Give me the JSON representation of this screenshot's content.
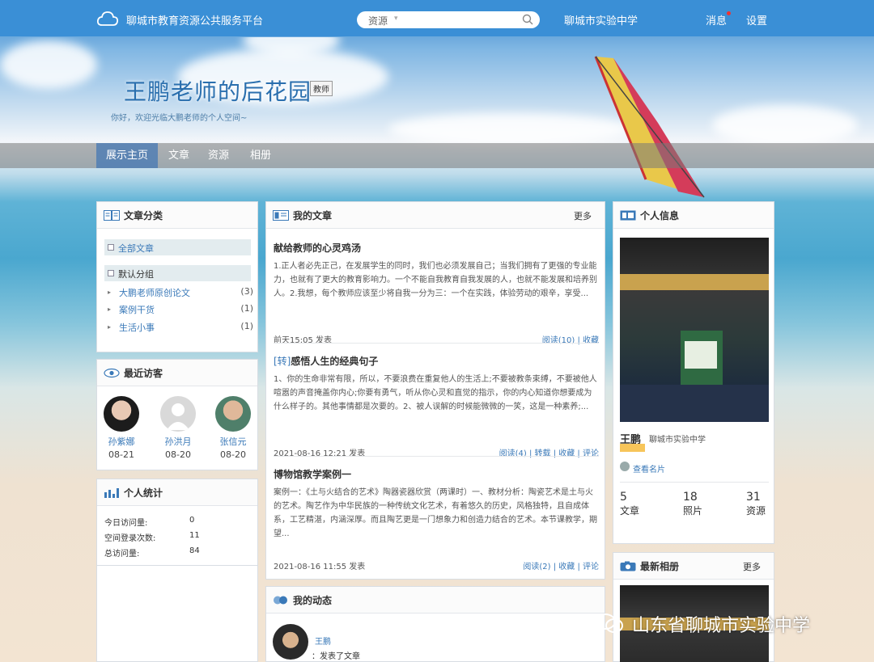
{
  "topbar": {
    "site_title": "聊城市教育资源公共服务平台",
    "search_scope": "资源",
    "search_caret": "▾",
    "school": "聊城市实验中学",
    "messages": "消息",
    "settings": "设置"
  },
  "hero": {
    "title": "王鹏老师的后花园",
    "badge": "教师",
    "subtitle": "你好，欢迎光临大鹏老师的个人空间~"
  },
  "nav": {
    "items": [
      {
        "label": "展示主页",
        "active": true
      },
      {
        "label": "文章",
        "active": false
      },
      {
        "label": "资源",
        "active": false
      },
      {
        "label": "相册",
        "active": false
      }
    ]
  },
  "categories": {
    "title": "文章分类",
    "all": "全部文章",
    "default_group": "默认分组",
    "items": [
      {
        "name": "大鹏老师原创论文",
        "count": "(3)"
      },
      {
        "name": "案例干货",
        "count": "(1)"
      },
      {
        "name": "生活小事",
        "count": "(1)"
      }
    ]
  },
  "visitors": {
    "title": "最近访客",
    "items": [
      {
        "name": "孙紫娜",
        "date": "08-21"
      },
      {
        "name": "孙洪月",
        "date": "08-20"
      },
      {
        "name": "张信元",
        "date": "08-20"
      }
    ]
  },
  "stats": {
    "title": "个人统计",
    "rows": [
      {
        "label": "今日访问量:",
        "value": "0"
      },
      {
        "label": "空间登录次数:",
        "value": "11"
      },
      {
        "label": "总访问量:",
        "value": "84"
      }
    ]
  },
  "articles": {
    "title": "我的文章",
    "more": "更多",
    "items": [
      {
        "tag": "",
        "title": "献给教师的心灵鸡汤",
        "body": "1.正人者必先正己，在发展学生的同时，我们也必须发展自己；当我们拥有了更强的专业能力，也就有了更大的教育影响力。一个不能自我教育自我发展的人，也就不能发展和培养别人。2.我想，每个教师应该至少将自我一分为三：一个在实践，体验劳动的艰辛，享受...",
        "time": "前天15:05 发表",
        "actions": "阅读(10) | 收藏"
      },
      {
        "tag": "[转]",
        "title": "感悟人生的经典句子",
        "body": "1、你的生命非常有限，所以，不要浪费在重复他人的生活上;不要被教条束缚，不要被他人喧嚣的声音掩盖你内心;你要有勇气，听从你心灵和直觉的指示，你的内心知道你想要成为什么样子的。其他事情都是次要的。2、被人误解的时候能微微的一笑，这是一种素养;...",
        "time": "2021-08-16 12:21 发表",
        "actions": "阅读(4) | 转载 | 收藏 | 评论"
      },
      {
        "tag": "",
        "title": "博物馆教学案例一",
        "body": "案例一：《土与火结合的艺术》陶器瓷器欣赏（两课时）一、教材分析：陶瓷艺术是土与火的艺术。陶艺作为中华民族的一种传统文化艺术，有着悠久的历史，风格独特，且自成体系，工艺精湛，内涵深厚。而且陶艺更是一门想象力和创造力结合的艺术。本节课教学，期望...",
        "time": "2021-08-16 11:55 发表",
        "actions": "阅读(2) | 收藏 | 评论"
      }
    ]
  },
  "dynamics": {
    "title": "我的动态",
    "user": "王鹏",
    "action": "：发表了文章"
  },
  "profile": {
    "title": "个人信息",
    "name": "王鹏",
    "school": "聊城市实验中学",
    "view_card": "查看名片",
    "stats": [
      {
        "value": "5",
        "label": "文章"
      },
      {
        "value": "18",
        "label": "照片"
      },
      {
        "value": "31",
        "label": "资源"
      }
    ]
  },
  "album": {
    "title": "最新相册",
    "more": "更多"
  },
  "watermark": "山东省聊城市实验中学"
}
